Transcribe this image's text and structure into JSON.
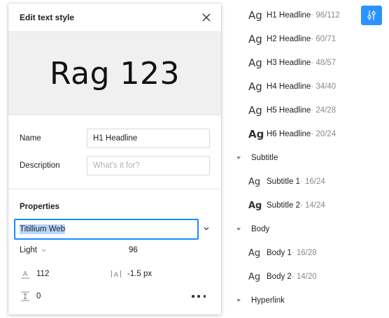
{
  "dialog": {
    "title": "Edit text style",
    "preview_text": "Rag 123",
    "name_label": "Name",
    "name_value": "H1 Headline",
    "description_label": "Description",
    "description_placeholder": "What's it for?",
    "properties_title": "Properties",
    "font_family": "Titillium Web",
    "font_weight": "Light",
    "font_size": "96",
    "line_height": "112",
    "letter_spacing": "-1.5 px",
    "paragraph_spacing": "0"
  },
  "styles": [
    {
      "ag": "Ag",
      "name": "H1 Headline",
      "meta": " · 96/112"
    },
    {
      "ag": "Ag",
      "name": "H2 Headline",
      "meta": " · 60/71"
    },
    {
      "ag": "Ag",
      "name": "H3 Headline",
      "meta": " · 48/57"
    },
    {
      "ag": "Ag",
      "name": "H4 Headline",
      "meta": " · 34/40"
    },
    {
      "ag": "Ag",
      "name": "H5 Headline",
      "meta": " · 24/28"
    },
    {
      "ag": "Ag",
      "name": "H6 Headline",
      "meta": " · 20/24"
    },
    {
      "group": "Subtitle"
    },
    {
      "ag": "Ag",
      "name": "Subtitle 1",
      "meta": " · 16/24"
    },
    {
      "ag": "Ag",
      "name": "Subtitle 2",
      "meta": " · 14/24"
    },
    {
      "group": "Body"
    },
    {
      "ag": "Ag",
      "name": "Body 1",
      "meta": " · 16/28"
    },
    {
      "ag": "Ag",
      "name": "Body 2",
      "meta": " · 14/20"
    },
    {
      "group": "Hyperlink"
    }
  ],
  "icons": {
    "close": "close-icon",
    "settings": "adjust-icon",
    "line_height": "line-height-icon",
    "letter_spacing": "letter-spacing-icon",
    "paragraph_spacing": "paragraph-spacing-icon",
    "more": "more-icon"
  },
  "colors": {
    "accent": "#1a8cff",
    "selection": "#b9d7fc",
    "preview_bg": "#f0f0f0"
  }
}
